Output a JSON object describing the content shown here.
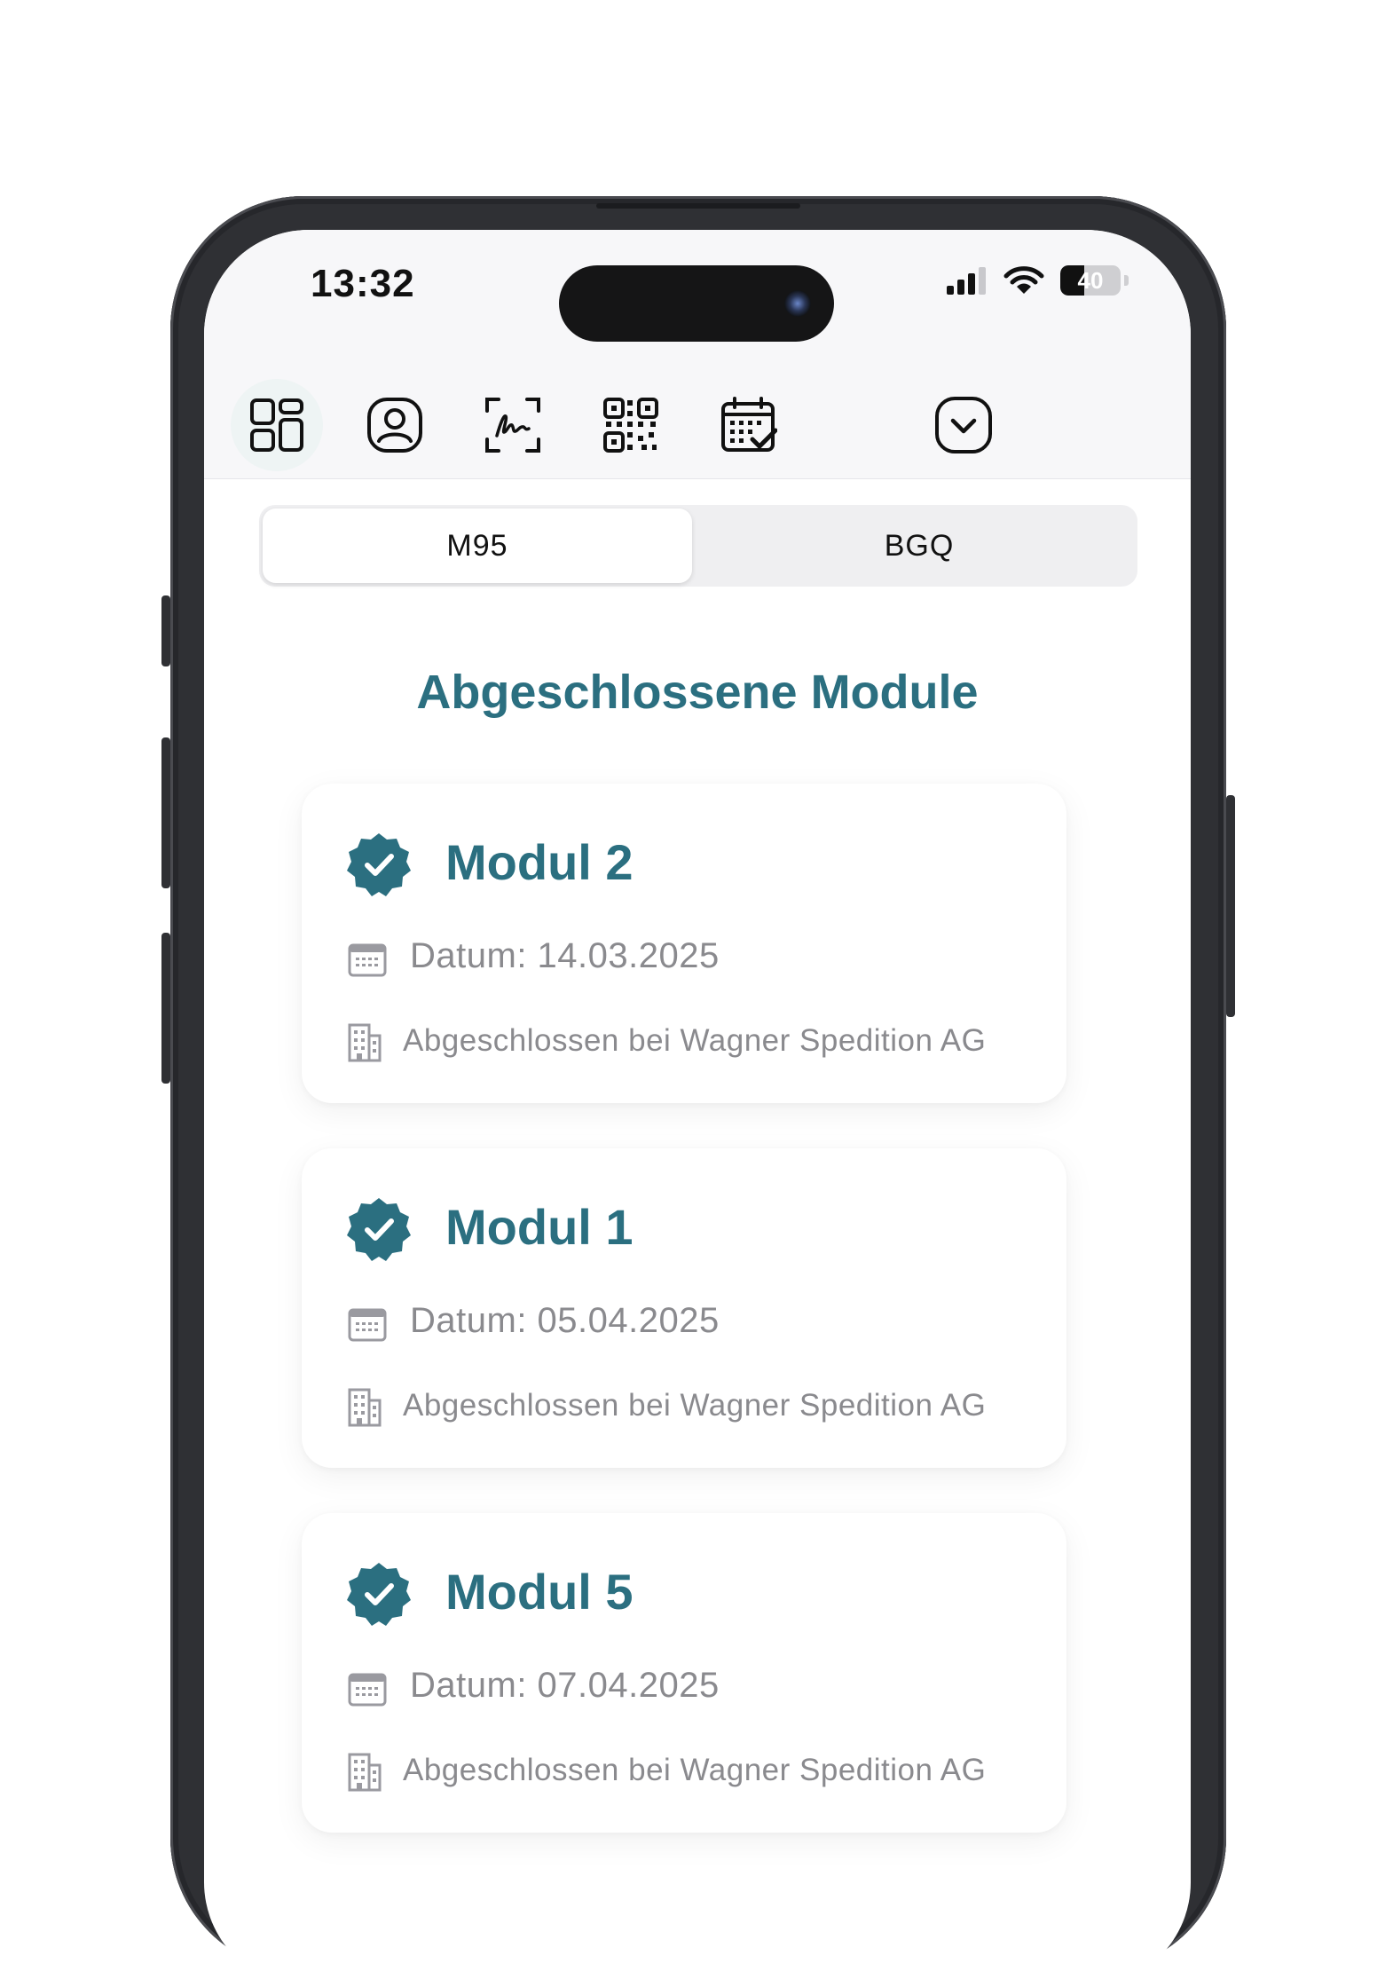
{
  "status_bar": {
    "time": "13:32",
    "battery": "40",
    "battery_level": 0.4
  },
  "toolbar": {
    "items": [
      {
        "icon": "dashboard-grid-icon",
        "active": true
      },
      {
        "icon": "profile-icon",
        "active": false
      },
      {
        "icon": "signature-scan-icon",
        "active": false
      },
      {
        "icon": "qr-code-icon",
        "active": false
      },
      {
        "icon": "calendar-check-icon",
        "active": false
      },
      {
        "icon": "chevron-down-circle-icon",
        "active": false
      }
    ]
  },
  "tabs": {
    "left": "M95",
    "right": "BGQ",
    "selected": "M95"
  },
  "heading": "Abgeschlossene Module",
  "modules": [
    {
      "title": "Modul 2",
      "date": "Datum: 14.03.2025",
      "location": "Abgeschlossen bei Wagner Spedition AG"
    },
    {
      "title": "Modul 1",
      "date": "Datum: 05.04.2025",
      "location": "Abgeschlossen bei Wagner Spedition AG"
    },
    {
      "title": "Modul 5",
      "date": "Datum: 07.04.2025",
      "location": "Abgeschlossen bei Wagner Spedition AG"
    }
  ],
  "colors": {
    "accent": "#2b6f80",
    "muted_text": "#8a8a8e",
    "frame": "#2f3034"
  }
}
